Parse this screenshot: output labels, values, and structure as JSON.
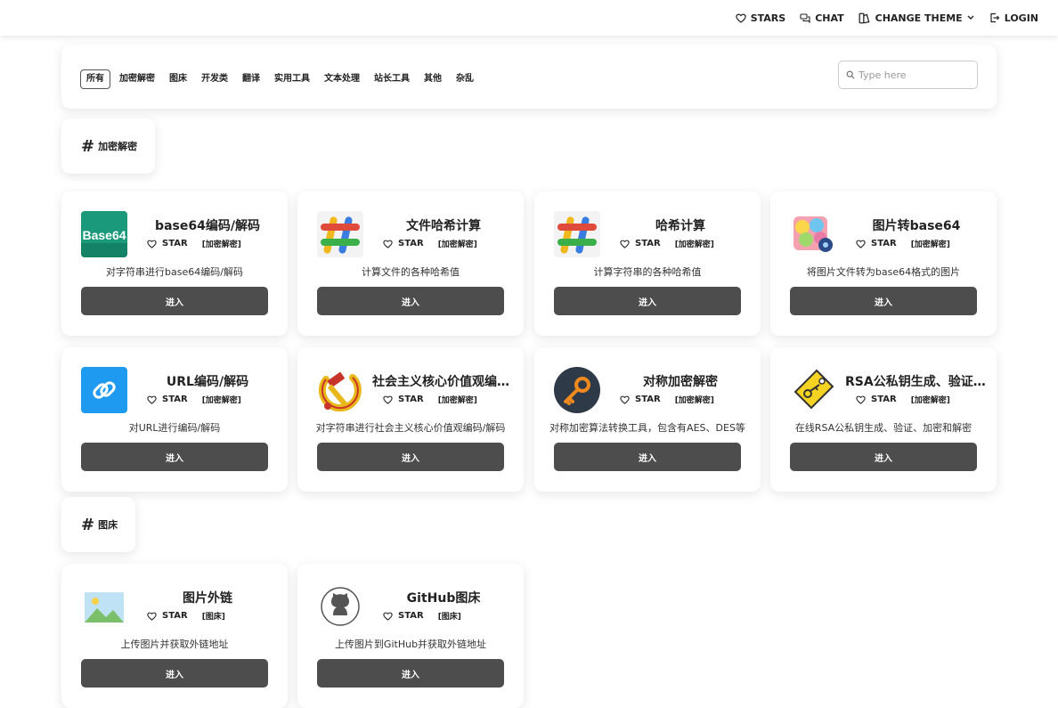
{
  "nav": {
    "stars": "STARS",
    "chat": "CHAT",
    "change_theme": "CHANGE THEME",
    "login": "LOGIN"
  },
  "filters": {
    "chips": [
      "所有",
      "加密解密",
      "图床",
      "开发类",
      "翻译",
      "实用工具",
      "文本处理",
      "站长工具",
      "其他",
      "杂乱"
    ],
    "active": "所有",
    "search_placeholder": "Type here"
  },
  "sections": [
    {
      "title": "加密解密",
      "tools": [
        {
          "name": "base64编码/解码",
          "star": "STAR",
          "category": "[加密解密]",
          "desc": "对字符串进行base64编码/解码",
          "button": "进入",
          "icon": "base64-icon"
        },
        {
          "name": "文件哈希计算",
          "star": "STAR",
          "category": "[加密解密]",
          "desc": "计算文件的各种哈希值",
          "button": "进入",
          "icon": "hash-icon"
        },
        {
          "name": "哈希计算",
          "star": "STAR",
          "category": "[加密解密]",
          "desc": "计算字符串的各种哈希值",
          "button": "进入",
          "icon": "hash-icon"
        },
        {
          "name": "图片转base64",
          "star": "STAR",
          "category": "[加密解密]",
          "desc": "将图片文件转为base64格式的图片",
          "button": "进入",
          "icon": "image-convert-icon"
        },
        {
          "name": "URL编码/解码",
          "star": "STAR",
          "category": "[加密解密]",
          "desc": "对URL进行编码/解码",
          "button": "进入",
          "icon": "link-icon"
        },
        {
          "name": "社会主义核心价值观编解码",
          "star": "STAR",
          "category": "[加密解密]",
          "desc": "对字符串进行社会主义核心价值观编码/解码",
          "button": "进入",
          "icon": "hammer-sickle-icon"
        },
        {
          "name": "对称加密解密",
          "star": "STAR",
          "category": "[加密解密]",
          "desc": "对称加密算法转换工具，包含有AES、DES等",
          "button": "进入",
          "icon": "key-icon"
        },
        {
          "name": "RSA公私钥生成、验证、加密和解密",
          "star": "STAR",
          "category": "[加密解密]",
          "desc": "在线RSA公私钥生成、验证、加密和解密",
          "button": "进入",
          "icon": "key-tag-icon"
        }
      ]
    },
    {
      "title": "图床",
      "tools": [
        {
          "name": "图片外链",
          "star": "STAR",
          "category": "[图床]",
          "desc": "上传图片并获取外链地址",
          "button": "进入",
          "icon": "picture-icon"
        },
        {
          "name": "GitHub图床",
          "star": "STAR",
          "category": "[图床]",
          "desc": "上传图片到GitHub并获取外链地址",
          "button": "进入",
          "icon": "github-icon"
        }
      ]
    }
  ]
}
